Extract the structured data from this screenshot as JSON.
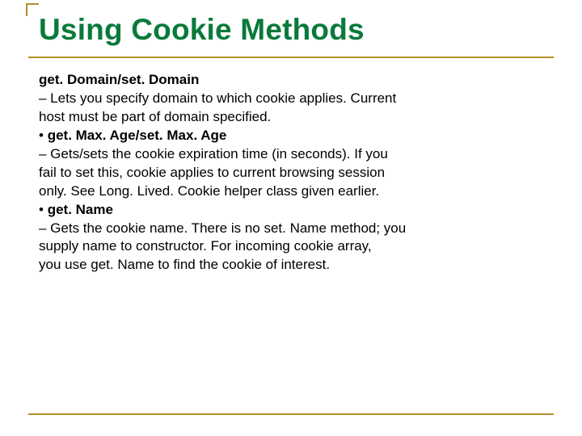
{
  "title": "Using Cookie Methods",
  "body": {
    "m1_head": "get. Domain/set. Domain",
    "m1_l1": "– Lets you specify domain to which cookie applies. Current",
    "m1_l2": "host must be part of domain specified.",
    "m2_bullet": "• ",
    "m2_head": "get. Max. Age/set. Max. Age",
    "m2_l1": "– Gets/sets the cookie expiration time (in seconds). If you",
    "m2_l2": "fail to set this, cookie applies to current browsing session",
    "m2_l3": "only. See Long. Lived. Cookie helper class given earlier.",
    "m3_bullet": "• ",
    "m3_head": "get. Name",
    "m3_l1": "– Gets the cookie name. There is no set. Name method; you",
    "m3_l2": "supply name to constructor. For incoming cookie array,",
    "m3_l3": "you use get. Name to find the cookie of interest."
  }
}
